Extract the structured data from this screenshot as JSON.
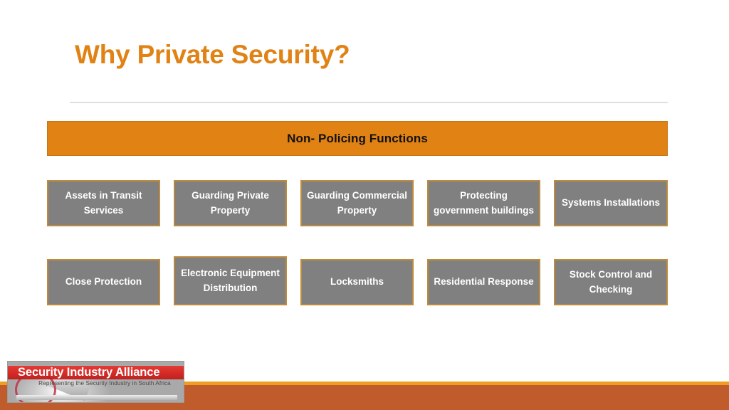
{
  "slide": {
    "title": "Why Private Security?"
  },
  "banner": {
    "label": "Non- Policing Functions",
    "background_color": "#E08214",
    "text_color": "#111111"
  },
  "boxes": {
    "fill_color": "#808080",
    "border_color": "#BE8A3C",
    "text_color": "#FFFFFF",
    "row1": [
      {
        "label": "Assets in Transit Services"
      },
      {
        "label": "Guarding Private Property"
      },
      {
        "label": "Guarding Commercial Property"
      },
      {
        "label": "Protecting government buildings"
      },
      {
        "label": "Systems Installations"
      }
    ],
    "row2": [
      {
        "label": "Close Protection"
      },
      {
        "label": "Electronic Equipment Distribution"
      },
      {
        "label": "Locksmiths"
      },
      {
        "label": "Residential Response"
      },
      {
        "label": "Stock Control and Checking"
      }
    ]
  },
  "logo": {
    "title": "Security Industry Alliance",
    "tagline": "Representing the Security Industry in South Africa",
    "band_color": "#D8201C"
  },
  "footer": {
    "strip_color": "#EE9F22",
    "bar_color": "#C05B2C"
  }
}
